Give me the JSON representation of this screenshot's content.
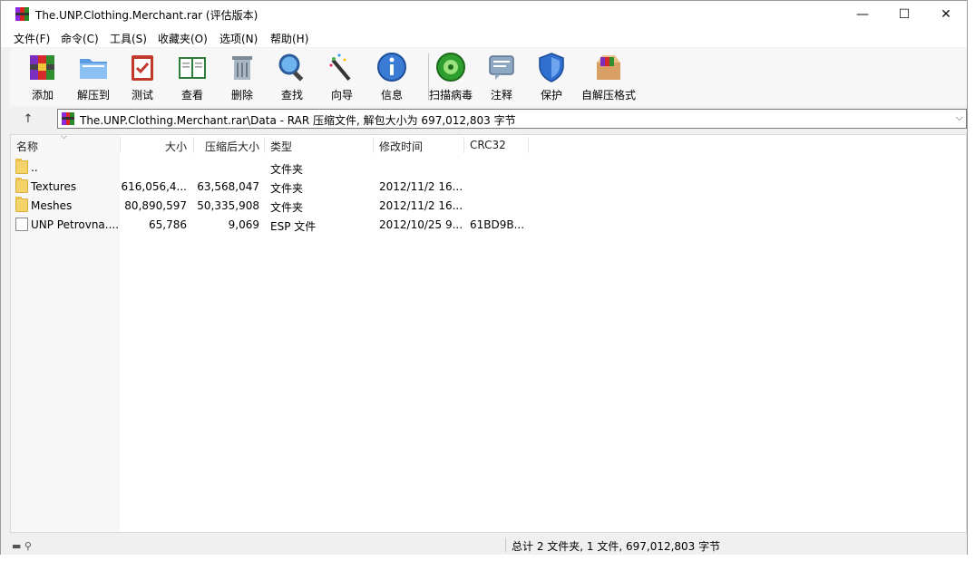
{
  "window": {
    "title": "The.UNP.Clothing.Merchant.rar (评估版本)",
    "minimize_glyph": "—",
    "maximize_glyph": "☐",
    "close_glyph": "✕"
  },
  "menu": [
    "文件(F)",
    "命令(C)",
    "工具(S)",
    "收藏夹(O)",
    "选项(N)",
    "帮助(H)"
  ],
  "toolbar": [
    {
      "label": "添加",
      "icon": "books-add-icon"
    },
    {
      "label": "解压到",
      "icon": "folder-extract-icon"
    },
    {
      "label": "测试",
      "icon": "clipboard-test-icon"
    },
    {
      "label": "查看",
      "icon": "book-view-icon"
    },
    {
      "label": "删除",
      "icon": "trash-icon"
    },
    {
      "label": "查找",
      "icon": "magnifier-icon"
    },
    {
      "label": "向导",
      "icon": "magic-wand-icon"
    },
    {
      "label": "信息",
      "icon": "info-icon"
    },
    {
      "label": "扫描病毒",
      "icon": "virus-scan-icon"
    },
    {
      "label": "注释",
      "icon": "comment-icon"
    },
    {
      "label": "保护",
      "icon": "shield-icon"
    },
    {
      "label": "自解压格式",
      "icon": "sfx-box-icon"
    }
  ],
  "address": {
    "path": "The.UNP.Clothing.Merchant.rar\\Data - RAR 压缩文件, 解包大小为 697,012,803 字节",
    "up_glyph": "↑",
    "dropdown_glyph": "⌵"
  },
  "columns": {
    "name": "名称",
    "size": "大小",
    "packed": "压缩后大小",
    "type": "类型",
    "modified": "修改时间",
    "crc": "CRC32"
  },
  "files": [
    {
      "name": "..",
      "size": "",
      "packed": "",
      "type": "文件夹",
      "modified": "",
      "crc": "",
      "kind": "folder"
    },
    {
      "name": "Textures",
      "size": "616,056,4...",
      "packed": "63,568,047",
      "type": "文件夹",
      "modified": "2012/11/2 16...",
      "crc": "",
      "kind": "folder"
    },
    {
      "name": "Meshes",
      "size": "80,890,597",
      "packed": "50,335,908",
      "type": "文件夹",
      "modified": "2012/11/2 16...",
      "crc": "",
      "kind": "folder"
    },
    {
      "name": "UNP Petrovna....",
      "size": "65,786",
      "packed": "9,069",
      "type": "ESP 文件",
      "modified": "2012/10/25 9...",
      "crc": "61BD9B...",
      "kind": "file"
    }
  ],
  "status": {
    "summary": "总计 2 文件夹, 1 文件, 697,012,803 字节",
    "icons": "▬ ⚲"
  },
  "colors": {
    "titlebar": "#ffffff",
    "toolbar": "#f7f7f7",
    "folder": "#f5d36b"
  }
}
